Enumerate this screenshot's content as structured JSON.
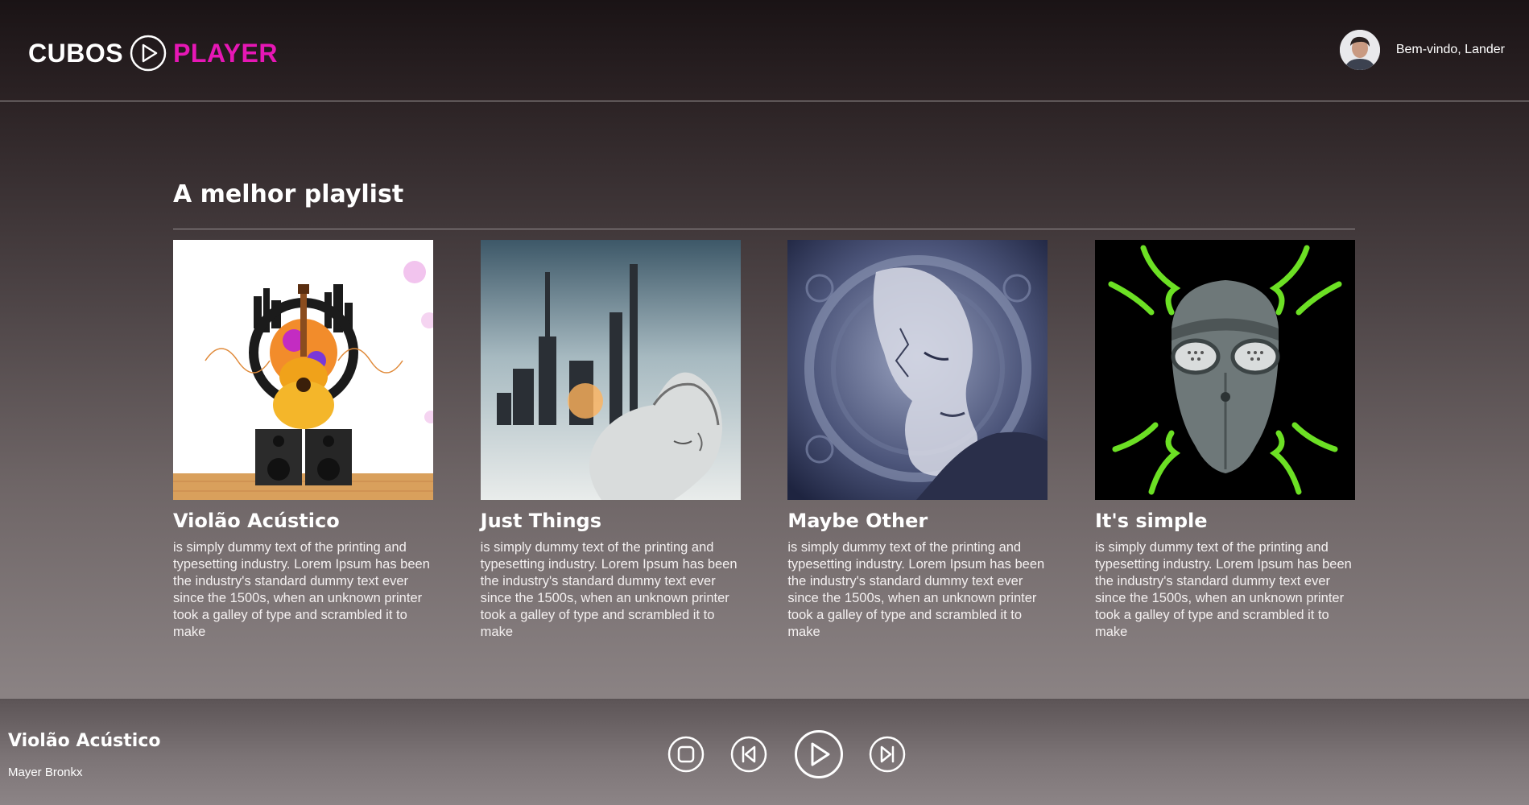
{
  "header": {
    "logo_left": "CUBOS",
    "logo_right": "PLAYER",
    "user_greeting": "Bem-vindo, Lander"
  },
  "colors": {
    "accent": "#e617b5",
    "text": "#ffffff"
  },
  "main": {
    "section_title": "A melhor playlist",
    "cards": [
      {
        "title": "Violão Acústico",
        "description": "is simply dummy text of the printing and typesetting industry. Lorem Ipsum has been the industry's standard dummy text ever since the 1500s, when an unknown printer took a galley of type and scrambled it to make"
      },
      {
        "title": "Just Things",
        "description": "is simply dummy text of the printing and typesetting industry. Lorem Ipsum has been the industry's standard dummy text ever since the 1500s, when an unknown printer took a galley of type and scrambled it to make"
      },
      {
        "title": "Maybe Other",
        "description": "is simply dummy text of the printing and typesetting industry. Lorem Ipsum has been the industry's standard dummy text ever since the 1500s, when an unknown printer took a galley of type and scrambled it to make"
      },
      {
        "title": "It's simple",
        "description": "is simply dummy text of the printing and typesetting industry. Lorem Ipsum has been the industry's standard dummy text ever since the 1500s, when an unknown printer took a galley of type and scrambled it to make"
      }
    ]
  },
  "player": {
    "now_playing_title": "Violão Acústico",
    "now_playing_artist": "Mayer Bronkx",
    "controls": [
      "stop-icon",
      "previous-icon",
      "play-icon",
      "next-icon"
    ]
  }
}
